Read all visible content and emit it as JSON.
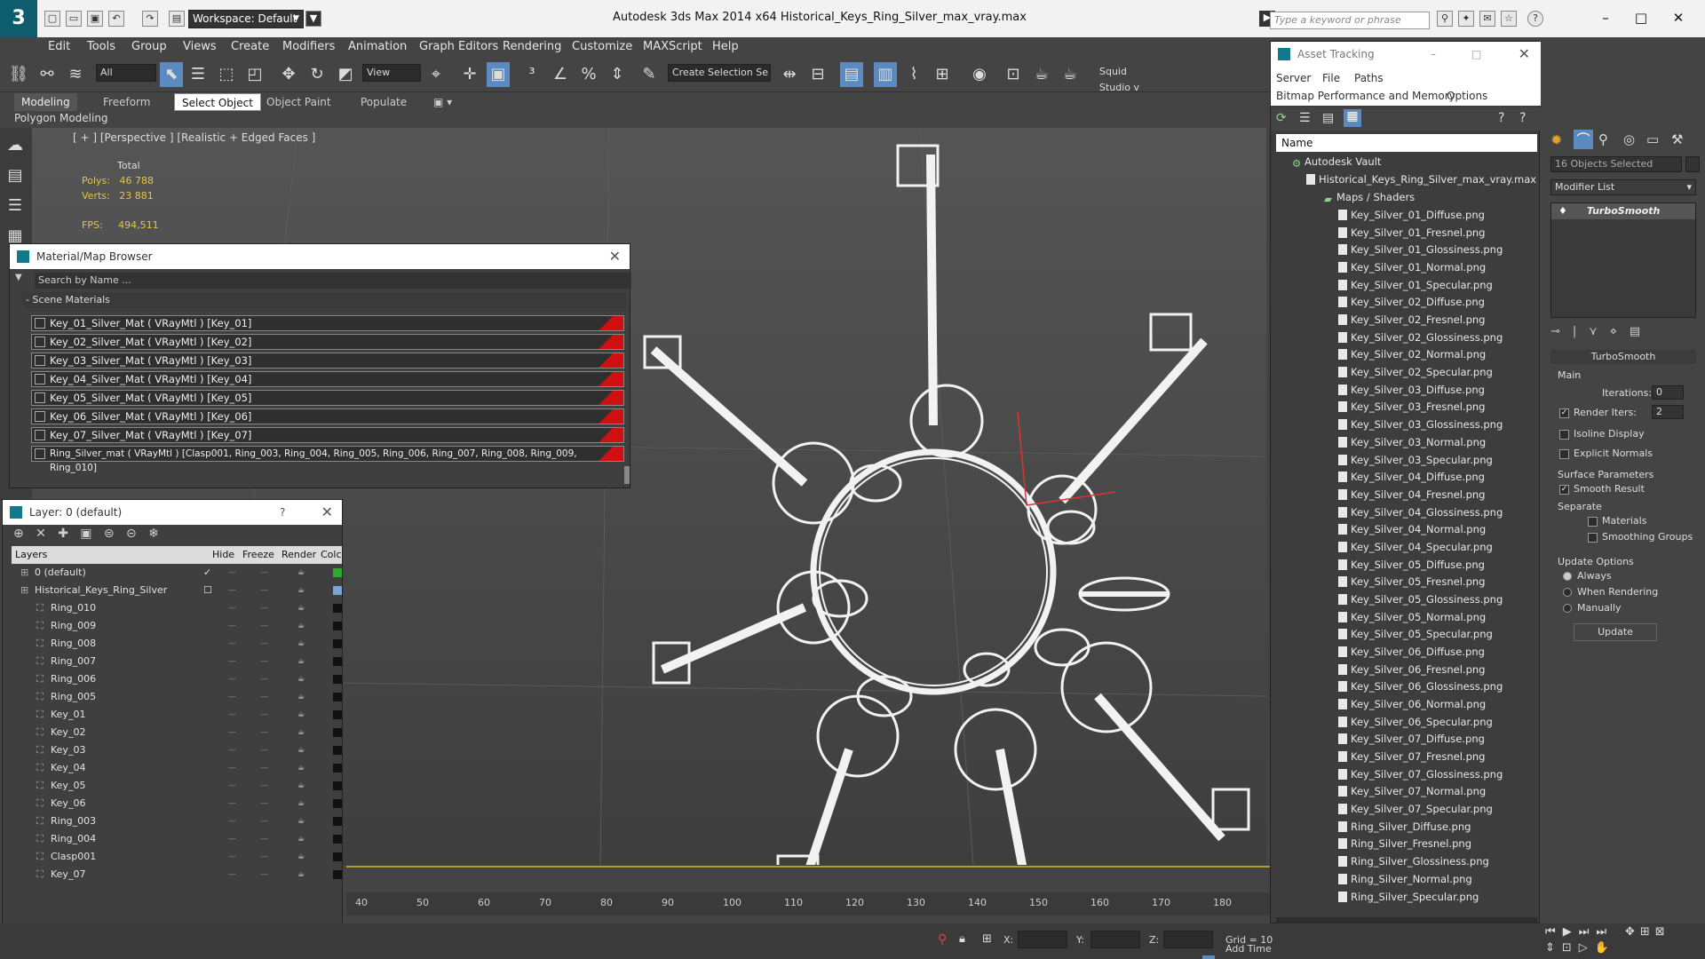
{
  "app": {
    "logo": "3",
    "workspace": "Workspace: Default",
    "title": "Autodesk 3ds Max  2014 x64     Historical_Keys_Ring_Silver_max_vray.max",
    "search_placeholder": "Type a keyword or phrase"
  },
  "menu": [
    "Edit",
    "Tools",
    "Group",
    "Views",
    "Create",
    "Modifiers",
    "Animation",
    "Graph Editors",
    "Rendering",
    "Customize",
    "MAXScript",
    "Help"
  ],
  "toolbar": {
    "filter": "All",
    "view": "View",
    "selection_set": "Create Selection Se",
    "squid": "Squid Studio v"
  },
  "ribbon": {
    "tabs": [
      "Modeling",
      "Freeform",
      "Select Object",
      "Object Paint",
      "Populate"
    ],
    "sub": "Polygon Modeling"
  },
  "viewport": {
    "label": "[ + ] [Perspective ] [Realistic + Edged Faces ]",
    "total": "Total",
    "polys_label": "Polys:",
    "polys": "46 788",
    "verts_label": "Verts:",
    "verts": "23 881",
    "fps_label": "FPS:",
    "fps": "494,511"
  },
  "material_browser": {
    "title": "Material/Map Browser",
    "search": "Search by Name ...",
    "section": "- Scene Materials",
    "rows": [
      "Key_01_Silver_Mat  ( VRayMtl ) [Key_01]",
      "Key_02_Silver_Mat  ( VRayMtl ) [Key_02]",
      "Key_03_Silver_Mat  ( VRayMtl ) [Key_03]",
      "Key_04_Silver_Mat  ( VRayMtl ) [Key_04]",
      "Key_05_Silver_Mat  ( VRayMtl ) [Key_05]",
      "Key_06_Silver_Mat  ( VRayMtl ) [Key_06]",
      "Key_07_Silver_Mat  ( VRayMtl ) [Key_07]",
      "Ring_Silver_mat  ( VRayMtl ) [Clasp001, Ring_003, Ring_004, Ring_005, Ring_006, Ring_007, Ring_008, Ring_009, Ring_010]"
    ]
  },
  "layer_panel": {
    "title": "Layer: 0 (default)",
    "help": "?",
    "cols": {
      "layers": "Layers",
      "hide": "Hide",
      "freeze": "Freeze",
      "render": "Render",
      "color": "Colc"
    },
    "dots": "—",
    "rows": [
      {
        "name": "0 (default)",
        "indent": 0,
        "color": "#2fa82f"
      },
      {
        "name": "Historical_Keys_Ring_Silver",
        "indent": 0,
        "color": "#7aa6d6"
      },
      {
        "name": "Ring_010",
        "indent": 1,
        "color": "#111111"
      },
      {
        "name": "Ring_009",
        "indent": 1,
        "color": "#111111"
      },
      {
        "name": "Ring_008",
        "indent": 1,
        "color": "#111111"
      },
      {
        "name": "Ring_007",
        "indent": 1,
        "color": "#111111"
      },
      {
        "name": "Ring_006",
        "indent": 1,
        "color": "#111111"
      },
      {
        "name": "Ring_005",
        "indent": 1,
        "color": "#111111"
      },
      {
        "name": "Key_01",
        "indent": 1,
        "color": "#111111"
      },
      {
        "name": "Key_02",
        "indent": 1,
        "color": "#111111"
      },
      {
        "name": "Key_03",
        "indent": 1,
        "color": "#111111"
      },
      {
        "name": "Key_04",
        "indent": 1,
        "color": "#111111"
      },
      {
        "name": "Key_05",
        "indent": 1,
        "color": "#111111"
      },
      {
        "name": "Key_06",
        "indent": 1,
        "color": "#111111"
      },
      {
        "name": "Ring_003",
        "indent": 1,
        "color": "#111111"
      },
      {
        "name": "Ring_004",
        "indent": 1,
        "color": "#111111"
      },
      {
        "name": "Clasp001",
        "indent": 1,
        "color": "#111111"
      },
      {
        "name": "Key_07",
        "indent": 1,
        "color": "#111111"
      }
    ]
  },
  "asset_tracking": {
    "title": "Asset Tracking",
    "menu": [
      "Server",
      "File",
      "Paths"
    ],
    "menu2": [
      "Bitmap Performance and Memory",
      "Options"
    ],
    "name_header": "Name",
    "vault": "Autodesk Vault",
    "file": "Historical_Keys_Ring_Silver_max_vray.max",
    "maps": "Maps / Shaders",
    "assets": [
      "Key_Silver_01_Diffuse.png",
      "Key_Silver_01_Fresnel.png",
      "Key_Silver_01_Glossiness.png",
      "Key_Silver_01_Normal.png",
      "Key_Silver_01_Specular.png",
      "Key_Silver_02_Diffuse.png",
      "Key_Silver_02_Fresnel.png",
      "Key_Silver_02_Glossiness.png",
      "Key_Silver_02_Normal.png",
      "Key_Silver_02_Specular.png",
      "Key_Silver_03_Diffuse.png",
      "Key_Silver_03_Fresnel.png",
      "Key_Silver_03_Glossiness.png",
      "Key_Silver_03_Normal.png",
      "Key_Silver_03_Specular.png",
      "Key_Silver_04_Diffuse.png",
      "Key_Silver_04_Fresnel.png",
      "Key_Silver_04_Glossiness.png",
      "Key_Silver_04_Normal.png",
      "Key_Silver_04_Specular.png",
      "Key_Silver_05_Diffuse.png",
      "Key_Silver_05_Fresnel.png",
      "Key_Silver_05_Glossiness.png",
      "Key_Silver_05_Normal.png",
      "Key_Silver_05_Specular.png",
      "Key_Silver_06_Diffuse.png",
      "Key_Silver_06_Fresnel.png",
      "Key_Silver_06_Glossiness.png",
      "Key_Silver_06_Normal.png",
      "Key_Silver_06_Specular.png",
      "Key_Silver_07_Diffuse.png",
      "Key_Silver_07_Fresnel.png",
      "Key_Silver_07_Glossiness.png",
      "Key_Silver_07_Normal.png",
      "Key_Silver_07_Specular.png",
      "Ring_Silver_Diffuse.png",
      "Ring_Silver_Fresnel.png",
      "Ring_Silver_Glossiness.png",
      "Ring_Silver_Normal.png",
      "Ring_Silver_Specular.png"
    ]
  },
  "command_panel": {
    "selected": "16 Objects Selected",
    "modifier_list": "Modifier List",
    "stack_item": "TurboSmooth",
    "rollout": "TurboSmooth",
    "main": "Main",
    "iterations_label": "Iterations:",
    "iterations": "0",
    "render_iters_label": "Render Iters:",
    "render_iters": "2",
    "isoline": "Isoline Display",
    "explicit": "Explicit Normals",
    "surface": "Surface Parameters",
    "smooth": "Smooth Result",
    "separate": "Separate",
    "materials": "Materials",
    "smoothing": "Smoothing Groups",
    "update_options": "Update Options",
    "always": "Always",
    "when_rendering": "When Rendering",
    "manually": "Manually",
    "update": "Update"
  },
  "timeline": {
    "ticks": [
      "40",
      "50",
      "60",
      "70",
      "80",
      "90",
      "100",
      "110",
      "120",
      "130",
      "140",
      "150",
      "160",
      "170",
      "180"
    ]
  },
  "status": {
    "x": "X:",
    "y": "Y:",
    "z": "Z:",
    "grid": "Grid = 10",
    "add_time": "Add Time"
  },
  "colors": {
    "accent": "#5a8ac0",
    "swatch": "#d01010",
    "logo": "#0e5d6c"
  }
}
